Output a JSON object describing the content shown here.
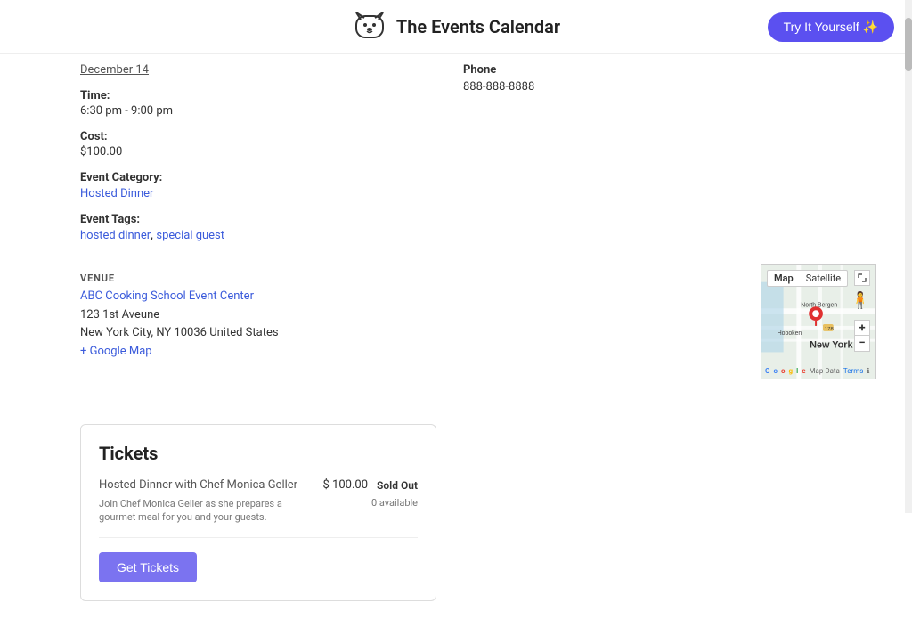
{
  "header": {
    "title": "The Events Calendar",
    "logo_alt": "Events Calendar Logo",
    "try_button_label": "Try It Yourself ✨"
  },
  "event_details": {
    "date": "December 14",
    "time_label": "Time:",
    "time_value": "6:30 pm - 9:00 pm",
    "cost_label": "Cost:",
    "cost_value": "$100.00",
    "category_label": "Event Category:",
    "category_link": "Hosted Dinner",
    "tags_label": "Event Tags:",
    "tag1": "hosted dinner",
    "tag2": "special guest"
  },
  "contact": {
    "phone_label": "Phone",
    "phone_value": "888-888-8888"
  },
  "venue": {
    "section_label": "VENUE",
    "name": "ABC Cooking School Event Center",
    "address_line1": "123 1st Aveune",
    "address_line2": "New York City, NY 10036 United States",
    "google_map_link": "+ Google Map"
  },
  "map": {
    "tab_map": "Map",
    "tab_satellite": "Satellite",
    "zoom_in": "+",
    "zoom_out": "−",
    "google_text": "Google",
    "map_data": "Map Data",
    "terms": "Terms"
  },
  "tickets": {
    "section_title": "Tickets",
    "ticket_name": "Hosted Dinner with Chef Monica Geller",
    "ticket_price": "$ 100.00",
    "ticket_available": "0 available",
    "ticket_sold_out": "Sold Out",
    "ticket_description": "Join Chef Monica Geller as she prepares a gourmet meal for you and your guests.",
    "get_tickets_label": "Get Tickets"
  }
}
